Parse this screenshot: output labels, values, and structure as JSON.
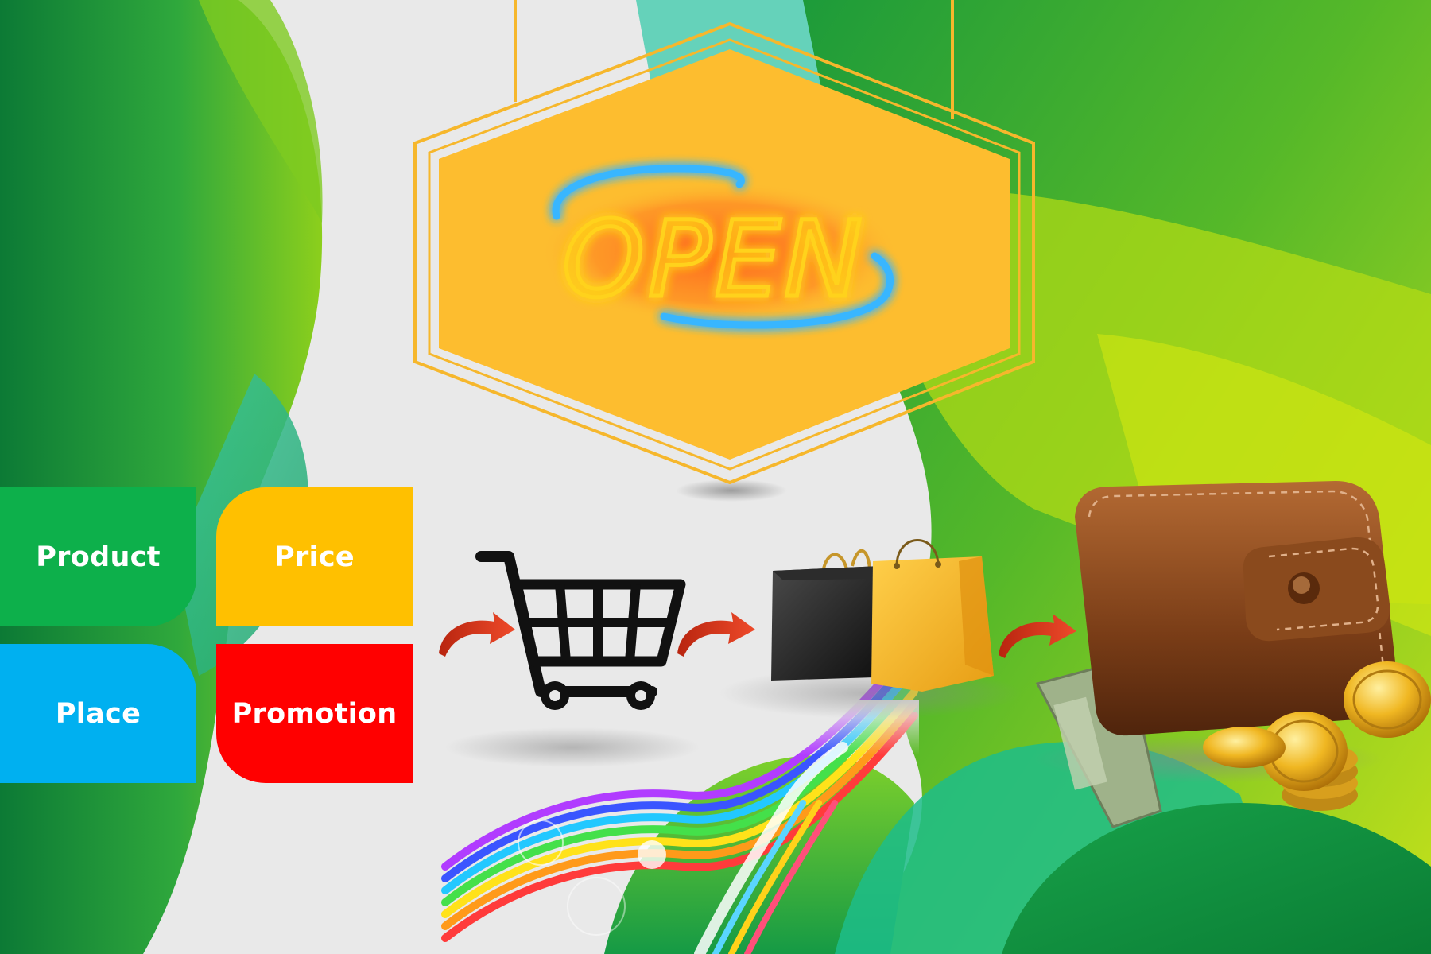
{
  "sign": {
    "text": "OPEN"
  },
  "marketing_mix": {
    "product": {
      "label": "Product",
      "color": "#0db04b"
    },
    "price": {
      "label": "Price",
      "color": "#ffc000"
    },
    "place": {
      "label": "Place",
      "color": "#00b0f0"
    },
    "promotion": {
      "label": "Promotion",
      "color": "#ff0000"
    }
  },
  "icons": [
    "shopping-cart-icon",
    "shopping-bags-icon",
    "wallet-icon",
    "curved-arrow-icon",
    "open-neon-sign"
  ],
  "colors": {
    "sign_fill": "#fdbd2f",
    "arrow": "#d8391f",
    "green_dark": "#0f8a3c",
    "green_light": "#9ad41c"
  }
}
